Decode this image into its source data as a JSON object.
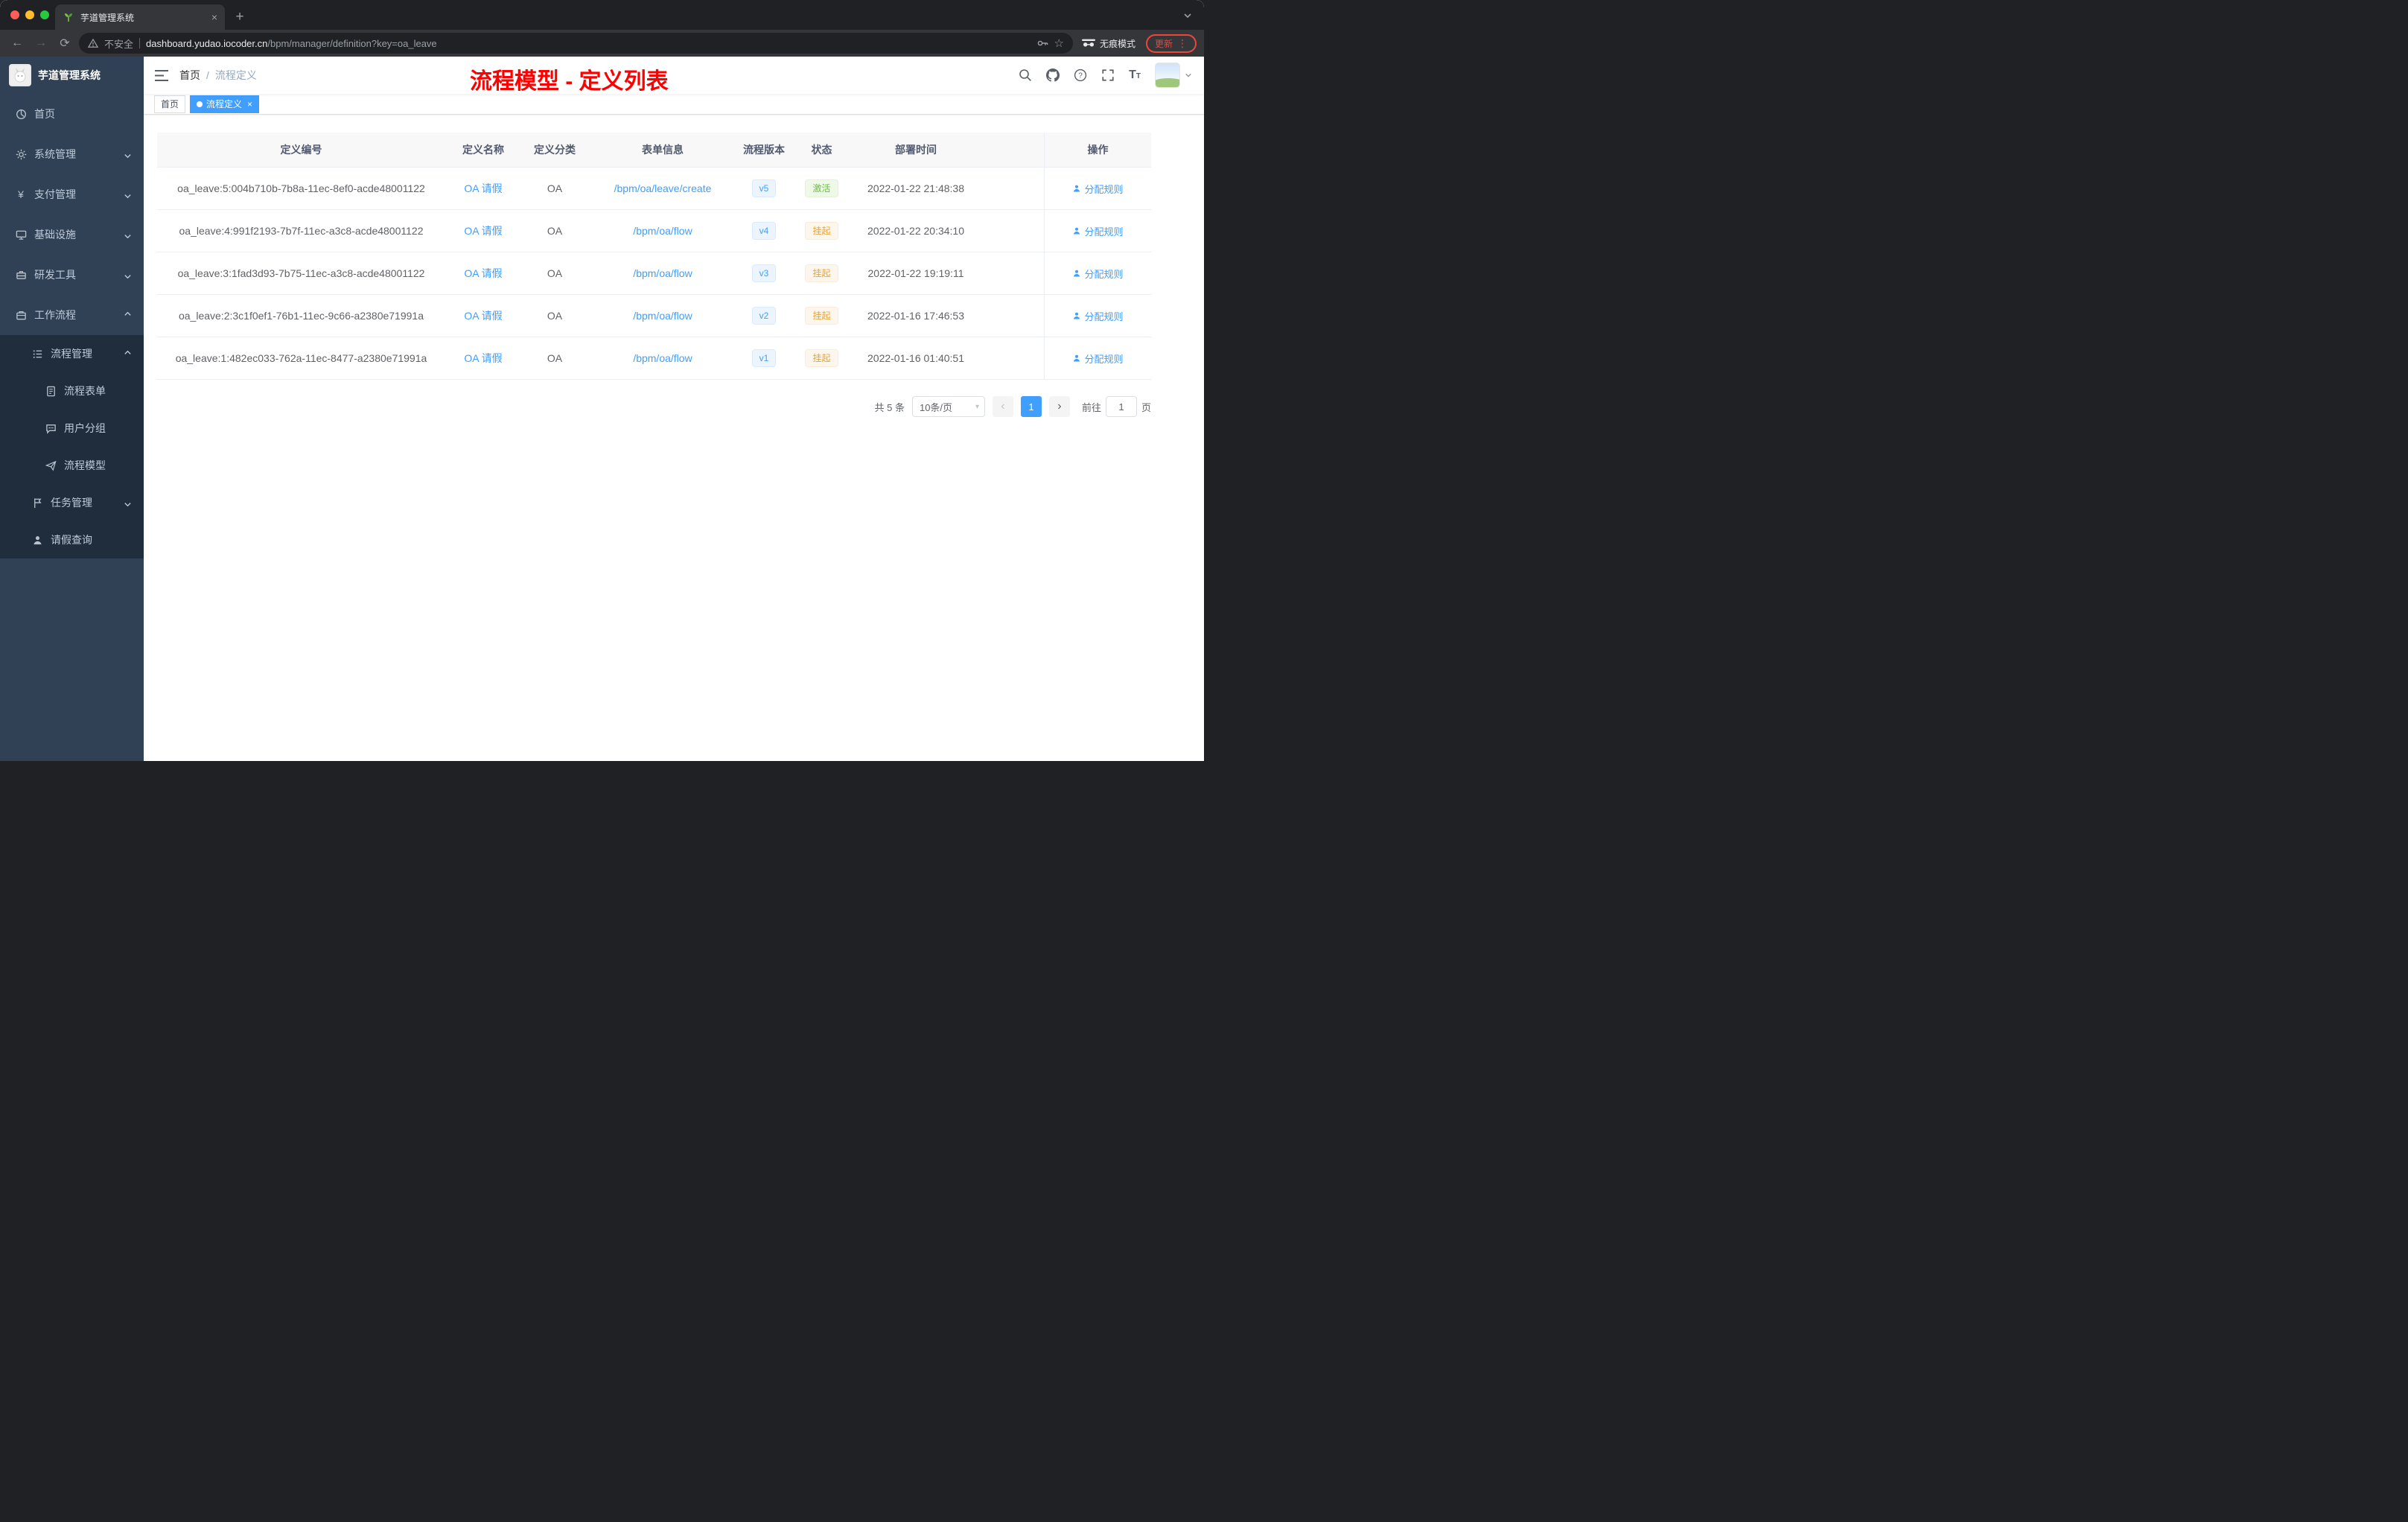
{
  "browser": {
    "tab_title": "芋道管理系统",
    "security_label": "不安全",
    "url_domain": "dashboard.yudao.iocoder.cn",
    "url_path": "/bpm/manager/definition?key=oa_leave",
    "incognito_label": "无痕模式",
    "update_label": "更新"
  },
  "sidebar": {
    "title": "芋道管理系统",
    "menu": [
      {
        "label": "首页"
      },
      {
        "label": "系统管理"
      },
      {
        "label": "支付管理"
      },
      {
        "label": "基础设施"
      },
      {
        "label": "研发工具"
      },
      {
        "label": "工作流程"
      },
      {
        "label": "流程管理"
      },
      {
        "label": "流程表单"
      },
      {
        "label": "用户分组"
      },
      {
        "label": "流程模型"
      },
      {
        "label": "任务管理"
      },
      {
        "label": "请假查询"
      }
    ]
  },
  "header": {
    "breadcrumb": [
      "首页",
      "流程定义"
    ],
    "separator": "/",
    "annotation": "流程模型 - 定义列表"
  },
  "tags": [
    {
      "label": "首页"
    },
    {
      "label": "流程定义"
    }
  ],
  "table": {
    "columns": [
      "定义编号",
      "定义名称",
      "定义分类",
      "表单信息",
      "流程版本",
      "状态",
      "部署时间",
      "操作"
    ],
    "rows": [
      {
        "id": "oa_leave:5:004b710b-7b8a-11ec-8ef0-acde48001122",
        "name": "OA 请假",
        "category": "OA",
        "form": "/bpm/oa/leave/create",
        "version": "v5",
        "status": {
          "label": "激活",
          "type": "success"
        },
        "deploy_time": "2022-01-22 21:48:38",
        "action": "分配规则"
      },
      {
        "id": "oa_leave:4:991f2193-7b7f-11ec-a3c8-acde48001122",
        "name": "OA 请假",
        "category": "OA",
        "form": "/bpm/oa/flow",
        "version": "v4",
        "status": {
          "label": "挂起",
          "type": "warning"
        },
        "deploy_time": "2022-01-22 20:34:10",
        "action": "分配规则"
      },
      {
        "id": "oa_leave:3:1fad3d93-7b75-11ec-a3c8-acde48001122",
        "name": "OA 请假",
        "category": "OA",
        "form": "/bpm/oa/flow",
        "version": "v3",
        "status": {
          "label": "挂起",
          "type": "warning"
        },
        "deploy_time": "2022-01-22 19:19:11",
        "action": "分配规则"
      },
      {
        "id": "oa_leave:2:3c1f0ef1-76b1-11ec-9c66-a2380e71991a",
        "name": "OA 请假",
        "category": "OA",
        "form": "/bpm/oa/flow",
        "version": "v2",
        "status": {
          "label": "挂起",
          "type": "warning"
        },
        "deploy_time": "2022-01-16 17:46:53",
        "action": "分配规则"
      },
      {
        "id": "oa_leave:1:482ec033-762a-11ec-8477-a2380e71991a",
        "name": "OA 请假",
        "category": "OA",
        "form": "/bpm/oa/flow",
        "version": "v1",
        "status": {
          "label": "挂起",
          "type": "warning"
        },
        "deploy_time": "2022-01-16 01:40:51",
        "action": "分配规则"
      }
    ]
  },
  "pagination": {
    "total": "共 5 条",
    "page_size": "10条/页",
    "page": "1",
    "goto_label": "前往",
    "goto_value": "1",
    "unit": "页"
  },
  "colors": {
    "accent": "#409eff",
    "success": "#67c23a",
    "warning": "#e6a23c",
    "annotation": "#ff0000",
    "sidebar": "#304156"
  }
}
